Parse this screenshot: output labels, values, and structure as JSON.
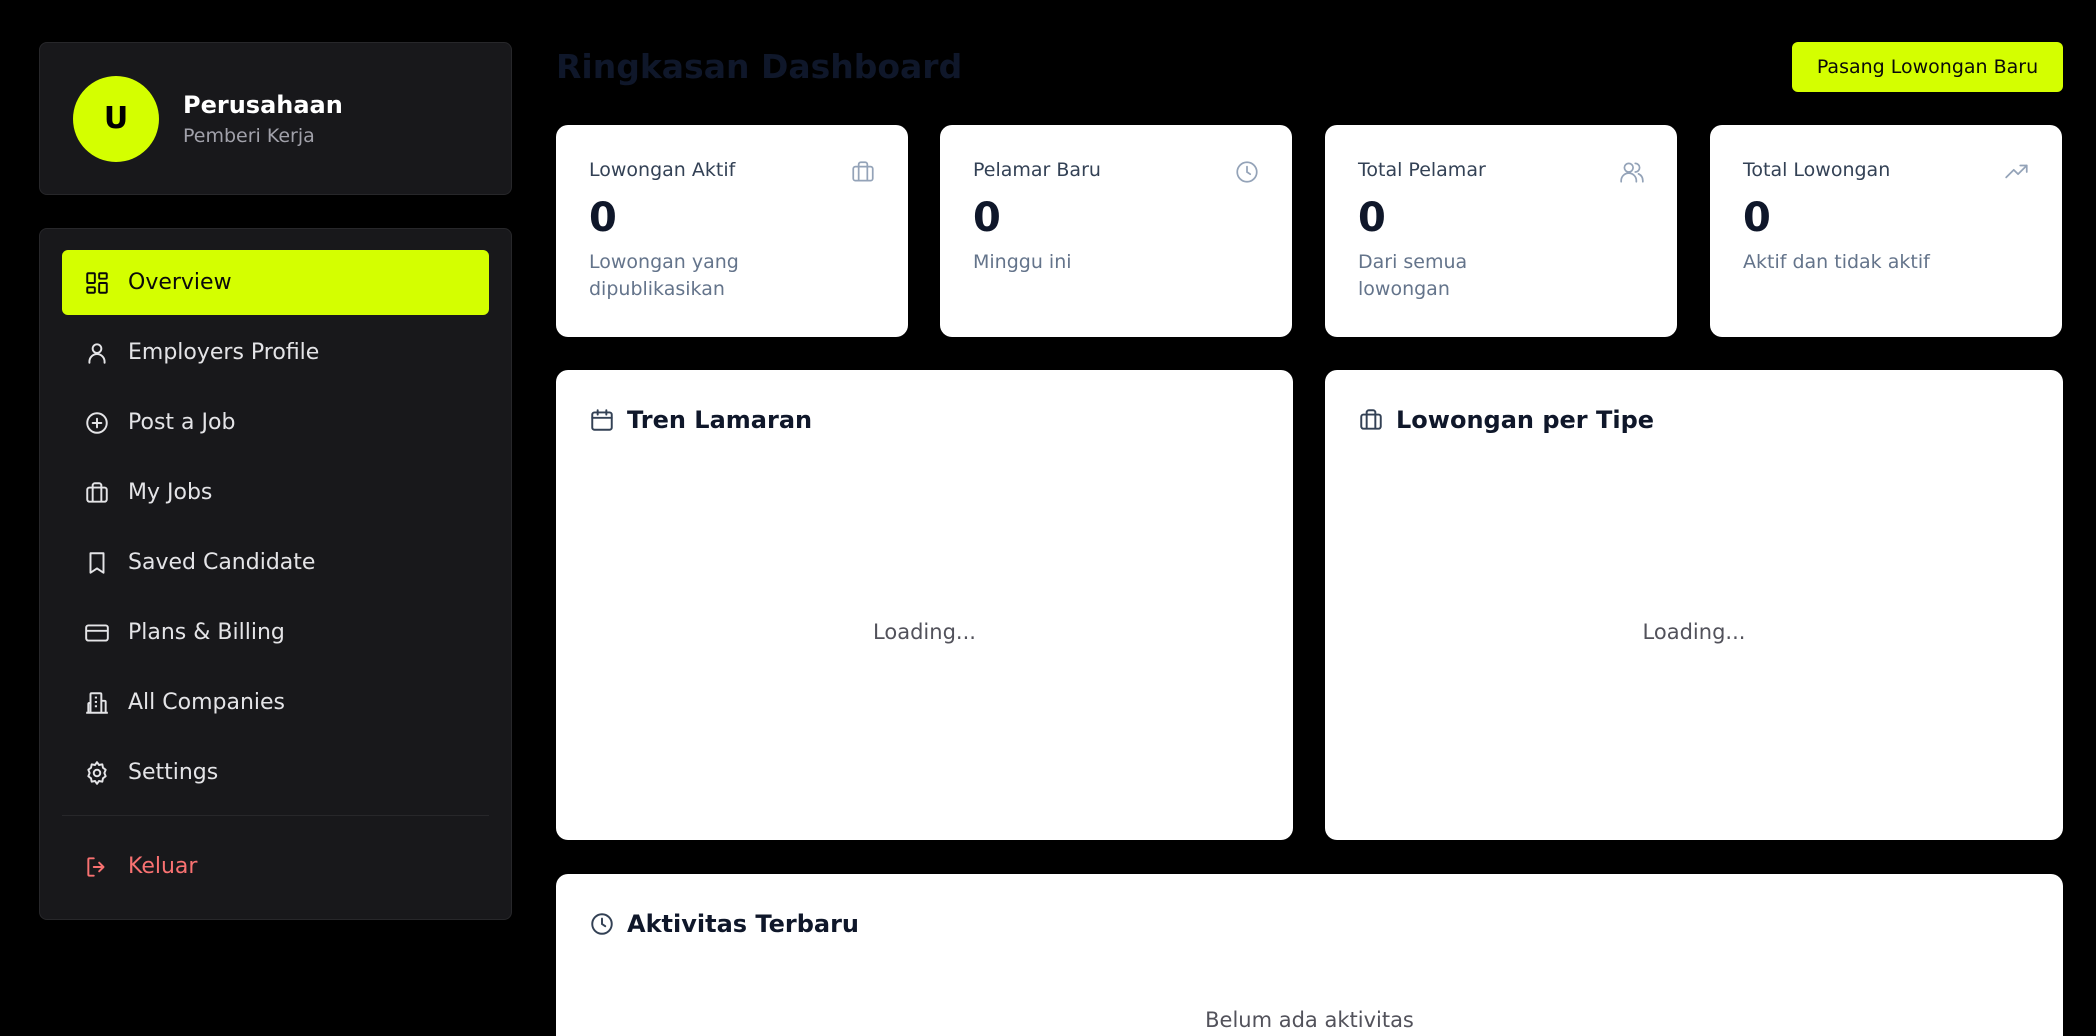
{
  "profile": {
    "avatar_initial": "U",
    "name": "Perusahaan",
    "role": "Pemberi Kerja"
  },
  "sidebar": {
    "items": [
      {
        "label": "Overview",
        "icon": "dashboard-icon",
        "active": true
      },
      {
        "label": "Employers Profile",
        "icon": "user-icon"
      },
      {
        "label": "Post a Job",
        "icon": "plus-circle-icon"
      },
      {
        "label": "My Jobs",
        "icon": "briefcase-icon"
      },
      {
        "label": "Saved Candidate",
        "icon": "bookmark-icon"
      },
      {
        "label": "Plans & Billing",
        "icon": "credit-card-icon"
      },
      {
        "label": "All Companies",
        "icon": "building-icon"
      },
      {
        "label": "Settings",
        "icon": "gear-icon"
      }
    ],
    "logout_label": "Keluar"
  },
  "header": {
    "title": "Ringkasan Dashboard",
    "primary_button": "Pasang Lowongan Baru"
  },
  "stats": [
    {
      "label": "Lowongan Aktif",
      "value": "0",
      "desc": "Lowongan yang dipublikasikan",
      "icon": "briefcase-icon"
    },
    {
      "label": "Pelamar Baru",
      "value": "0",
      "desc": "Minggu ini",
      "icon": "clock-icon"
    },
    {
      "label": "Total Pelamar",
      "value": "0",
      "desc": "Dari semua lowongan",
      "icon": "users-icon"
    },
    {
      "label": "Total Lowongan",
      "value": "0",
      "desc": "Aktif dan tidak aktif",
      "icon": "trending-up-icon"
    }
  ],
  "panels": {
    "trend": {
      "title": "Tren Lamaran",
      "status": "Loading...",
      "icon": "calendar-icon"
    },
    "by_type": {
      "title": "Lowongan per Tipe",
      "status": "Loading...",
      "icon": "briefcase-icon"
    },
    "activity": {
      "title": "Aktivitas Terbaru",
      "status": "Belum ada aktivitas",
      "icon": "clock-icon"
    }
  },
  "colors": {
    "accent": "#d4ff00",
    "sidebar_bg": "#18181b",
    "logout": "#f87171"
  }
}
